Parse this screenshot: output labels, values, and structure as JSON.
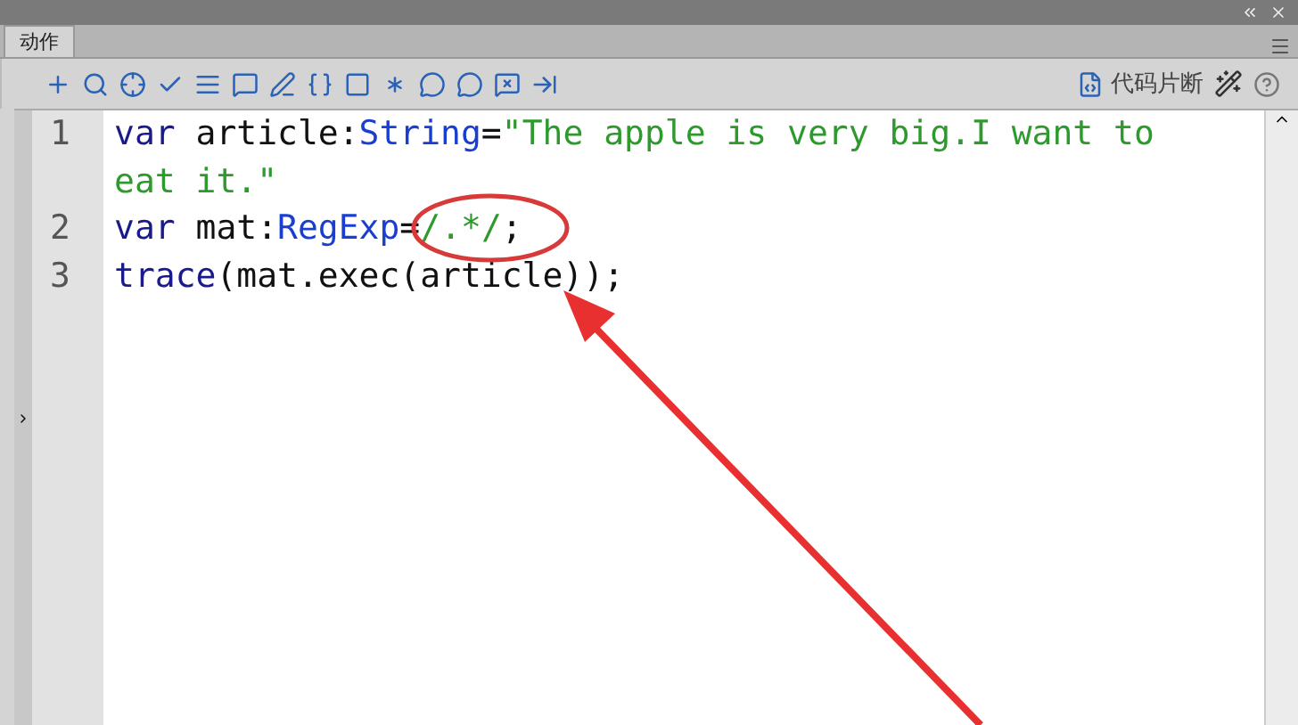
{
  "panel": {
    "tab": {
      "label": "动作",
      "selected": true
    },
    "snippets_label": "代码片断"
  },
  "code": [
    {
      "number": "1",
      "tokens": [
        {
          "kind": "keyword",
          "text": "var"
        },
        {
          "kind": "plain",
          "text": " article:"
        },
        {
          "kind": "type",
          "text": "String"
        },
        {
          "kind": "plain",
          "text": "="
        },
        {
          "kind": "string",
          "text": "\"The apple is very big.I want to eat it.\""
        }
      ]
    },
    {
      "number": "2",
      "tokens": [
        {
          "kind": "keyword",
          "text": "var"
        },
        {
          "kind": "plain",
          "text": " mat:"
        },
        {
          "kind": "type",
          "text": "RegExp"
        },
        {
          "kind": "plain",
          "text": "="
        },
        {
          "kind": "string",
          "text": "/.*/"
        },
        {
          "kind": "plain",
          "text": ";"
        }
      ]
    },
    {
      "number": "3",
      "tokens": [
        {
          "kind": "keyword",
          "text": "trace"
        },
        {
          "kind": "plain",
          "text": "(mat.exec(article));"
        }
      ]
    }
  ]
}
